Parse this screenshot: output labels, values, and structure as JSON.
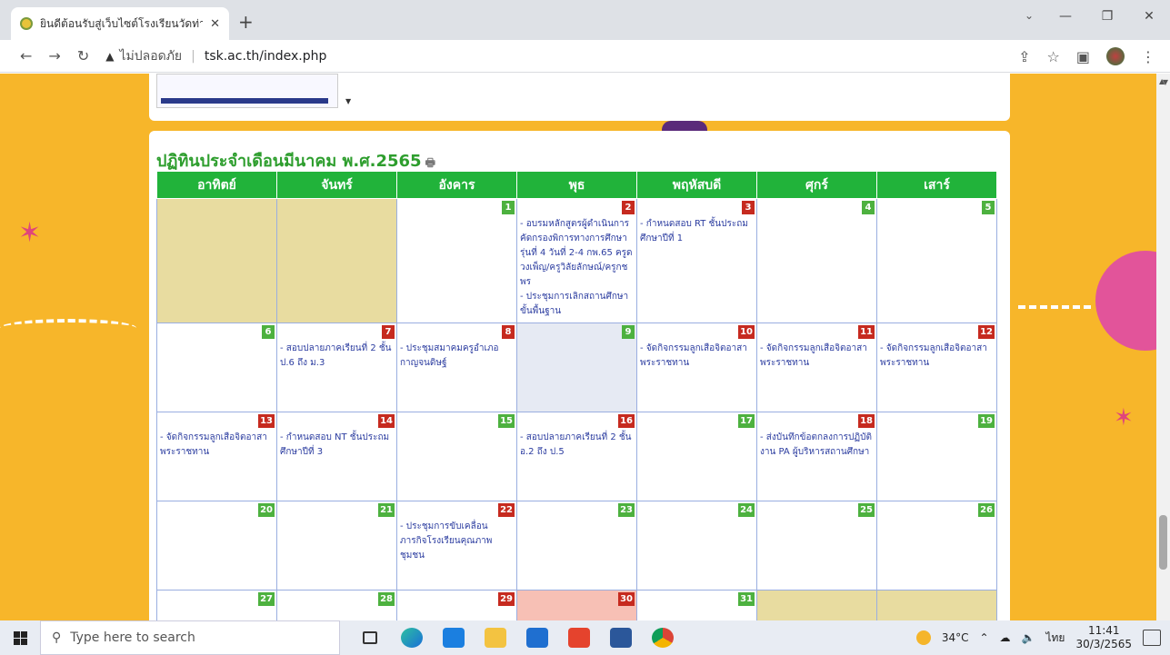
{
  "browser": {
    "tab_title": "ยินดีต้อนรับสู่เว็บไซต์โรงเรียนวัดท่าไทร",
    "tab_close": "✕",
    "new_tab": "+",
    "security_label": "ไม่ปลอดภัย",
    "url_host": "tsk.ac.th/index.php",
    "window_minimize": "—",
    "window_restore": "❐",
    "window_close": "✕"
  },
  "calendar": {
    "heading": "ปฏิทินประจำเดือนมีนาคม พ.ศ.2565",
    "weekdays": [
      "อาทิตย์",
      "จันทร์",
      "อังคาร",
      "พุธ",
      "พฤหัสบดี",
      "ศุกร์",
      "เสาร์"
    ],
    "weeks": [
      [
        {
          "day": "",
          "kind": "other",
          "events": []
        },
        {
          "day": "",
          "kind": "other",
          "events": []
        },
        {
          "day": "1",
          "badge": "g",
          "events": []
        },
        {
          "day": "2",
          "badge": "r",
          "events": [
            "- อบรมหลักสูตรผู้ดำเนินการคัดกรองพิการทางการศึกษา รุ่นที่ 4 วันที่ 2-4 กพ.65 ครูดวงเพ็ญ/ครูวิลัยลักษณ์/ครูกชพร",
            "- ประชุมการเลิกสถานศึกษาขั้นพื้นฐาน"
          ]
        },
        {
          "day": "3",
          "badge": "r",
          "events": [
            "- กำหนดสอบ RT ชั้นประถมศึกษาปีที่ 1"
          ]
        },
        {
          "day": "4",
          "badge": "g",
          "events": []
        },
        {
          "day": "5",
          "badge": "g",
          "events": []
        }
      ],
      [
        {
          "day": "6",
          "badge": "g",
          "events": []
        },
        {
          "day": "7",
          "badge": "r",
          "events": [
            "- สอบปลายภาคเรียนที่ 2 ชั้น ป.6 ถึง ม.3"
          ]
        },
        {
          "day": "8",
          "badge": "r",
          "events": [
            "- ประชุมสมาคมครูอำเภอกาญจนดิษฐ์"
          ]
        },
        {
          "day": "9",
          "badge": "g",
          "kind": "today",
          "events": []
        },
        {
          "day": "10",
          "badge": "r",
          "events": [
            "- จัดกิจกรรมลูกเสือจิตอาสาพระราชทาน"
          ]
        },
        {
          "day": "11",
          "badge": "r",
          "events": [
            "- จัดกิจกรรมลูกเสือจิตอาสาพระราชทาน"
          ]
        },
        {
          "day": "12",
          "badge": "r",
          "events": [
            "- จัดกิจกรรมลูกเสือจิตอาสาพระราชทาน"
          ]
        }
      ],
      [
        {
          "day": "13",
          "badge": "r",
          "events": [
            "- จัดกิจกรรมลูกเสือจิตอาสาพระราชทาน"
          ]
        },
        {
          "day": "14",
          "badge": "r",
          "events": [
            "- กำหนดสอบ NT ชั้นประถมศึกษาปีที่ 3"
          ]
        },
        {
          "day": "15",
          "badge": "g",
          "events": []
        },
        {
          "day": "16",
          "badge": "r",
          "events": [
            "- สอบปลายภาคเรียนที่ 2 ชั้น อ.2 ถึง ป.5"
          ]
        },
        {
          "day": "17",
          "badge": "g",
          "events": []
        },
        {
          "day": "18",
          "badge": "r",
          "events": [
            "- ส่งบันทึกข้อตกลงการปฏิบัติงาน PA ผู้บริหารสถานศึกษา"
          ]
        },
        {
          "day": "19",
          "badge": "g",
          "events": []
        }
      ],
      [
        {
          "day": "20",
          "badge": "g",
          "events": []
        },
        {
          "day": "21",
          "badge": "g",
          "events": []
        },
        {
          "day": "22",
          "badge": "r",
          "events": [
            "- ประชุมการขับเคลื่อนภารกิจโรงเรียนคุณภาพชุมชน"
          ]
        },
        {
          "day": "23",
          "badge": "g",
          "events": []
        },
        {
          "day": "24",
          "badge": "g",
          "events": []
        },
        {
          "day": "25",
          "badge": "g",
          "events": []
        },
        {
          "day": "26",
          "badge": "g",
          "events": []
        }
      ],
      [
        {
          "day": "27",
          "badge": "g",
          "events": []
        },
        {
          "day": "28",
          "badge": "g",
          "events": []
        },
        {
          "day": "29",
          "badge": "r",
          "events": []
        },
        {
          "day": "30",
          "badge": "r",
          "kind": "hl",
          "events": []
        },
        {
          "day": "31",
          "badge": "g",
          "events": []
        },
        {
          "day": "",
          "kind": "other",
          "events": []
        },
        {
          "day": "",
          "kind": "other",
          "events": []
        }
      ]
    ]
  },
  "taskbar": {
    "search_placeholder": "Type here to search",
    "temperature": "34°C",
    "language": "ไทย",
    "time": "11:41",
    "date": "30/3/2565"
  }
}
